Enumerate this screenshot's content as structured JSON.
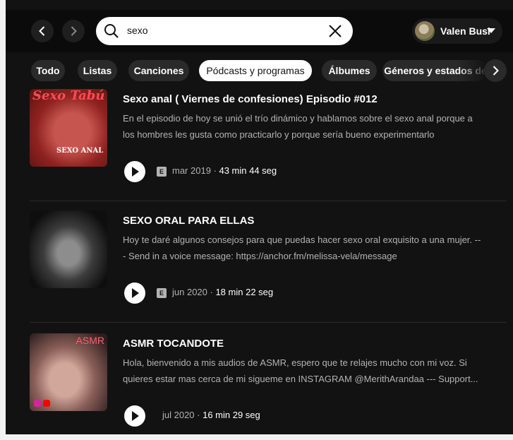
{
  "nav": {
    "back_icon": "chevron-left-icon",
    "forward_icon": "chevron-right-icon"
  },
  "search": {
    "value": "sexo",
    "icon": "search-icon",
    "clear_icon": "close-icon"
  },
  "user": {
    "name": "Valen Busi",
    "caret_icon": "chevron-down-icon"
  },
  "filters": {
    "chips": [
      {
        "label": "Todo"
      },
      {
        "label": "Listas"
      },
      {
        "label": "Canciones"
      },
      {
        "label": "Pódcasts y programas",
        "active": true
      },
      {
        "label": "Álbumes"
      },
      {
        "label": "Géneros y estados de"
      }
    ],
    "next_icon": "chevron-right-icon"
  },
  "episodes": [
    {
      "title": "Sexo anal ( Viernes de confesiones) Episodio #012",
      "description_line1": "En el episodio de hoy se unió el trío dinámico y hablamos sobre el sexo anal porque a",
      "description_line2": "los hombres les gusta como practicarlo y porque sería bueno experimentarlo",
      "explicit": "E",
      "date": "mar 2019",
      "duration": "43 min 44 seg",
      "thumb_text": "SEXO ANAL",
      "thumb_logo": "Sexo Tabú"
    },
    {
      "title": "SEXO ORAL PARA ELLAS",
      "description_line1": "Hoy te daré algunos consejos para que  puedas hacer sexo oral exquisito a una mujer. --",
      "description_line2": "- Send in a voice message: https://anchor.fm/melissa-vela/message",
      "explicit": "E",
      "date": "jun 2020",
      "duration": "18 min 22 seg"
    },
    {
      "title": "ASMR TOCANDOTE",
      "description_line1": "Hola, bienvenido a mis audios de ASMR, espero  que te relajes mucho con mi voz.  Si",
      "description_line2": "quieres estar mas cerca de mi sigueme en INSTAGRAM @MerithArandaa --- Support...",
      "date": "jul 2020",
      "duration": "16 min 29 seg",
      "thumb_text": "ASMR"
    }
  ],
  "meta_separator": " · ",
  "colors": {
    "background": "#121212",
    "chip": "#2a2a2a",
    "text_secondary": "#b3b3b3",
    "accent": "#ffffff"
  }
}
